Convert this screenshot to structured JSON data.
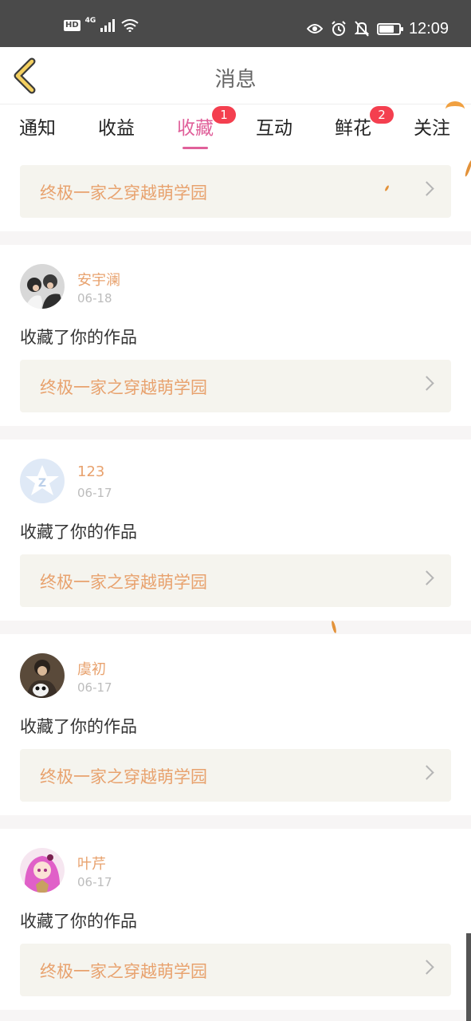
{
  "status_bar": {
    "hd": "HD",
    "network": "4G",
    "time": "12:09",
    "icons": [
      "signal-icon",
      "wifi-icon",
      "eye-icon",
      "alarm-icon",
      "mute-icon",
      "battery-icon"
    ]
  },
  "header": {
    "title": "消息",
    "back_icon": "chevron-left-icon"
  },
  "tabs": [
    {
      "label": "通知"
    },
    {
      "label": "收益"
    },
    {
      "label": "收藏",
      "badge": "1",
      "active": true
    },
    {
      "label": "互动"
    },
    {
      "label": "鲜花",
      "badge": "2"
    },
    {
      "label": "关注"
    }
  ],
  "first_link": {
    "title": "终极一家之穿越萌学园"
  },
  "items": [
    {
      "name": "安宇澜",
      "date": "06-18",
      "action": "收藏了你的作品",
      "work_title": "终极一家之穿越萌学园"
    },
    {
      "name": "123",
      "date": "06-17",
      "action": "收藏了你的作品",
      "work_title": "终极一家之穿越萌学园"
    },
    {
      "name": "虞初",
      "date": "06-17",
      "action": "收藏了你的作品",
      "work_title": "终极一家之穿越萌学园"
    },
    {
      "name": "叶芹",
      "date": "06-17",
      "action": "收藏了你的作品",
      "work_title": "终极一家之穿越萌学园"
    }
  ],
  "colors": {
    "accent": "#e0609a",
    "link_text": "#e8a26e",
    "badge": "#f43f4f",
    "status_bar": "#4a4a4a"
  }
}
